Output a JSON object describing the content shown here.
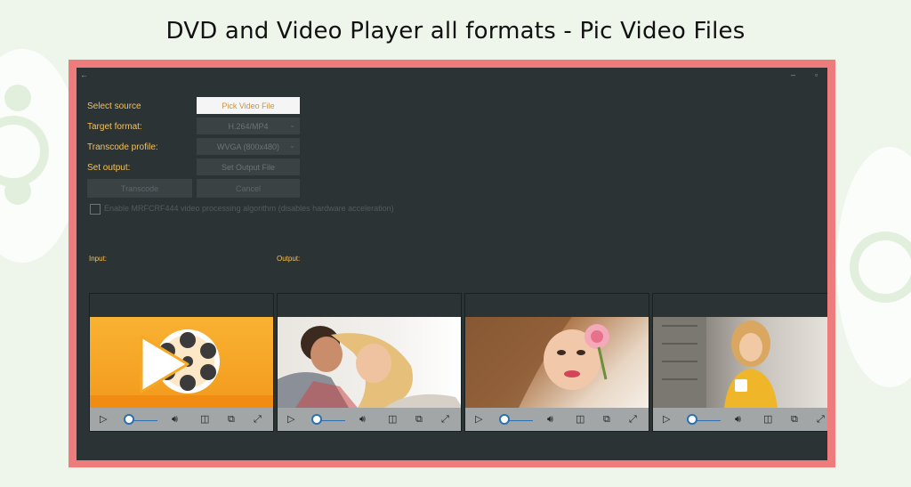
{
  "headline": "DVD and Video Player all formats - Pic Video Files",
  "app": {
    "back_icon": "←",
    "minimize_icon": "–",
    "restore_icon": "▫"
  },
  "form": {
    "select_source_label": "Select source",
    "pick_video_button": "Pick Video File",
    "target_format_label": "Target format:",
    "target_format_value": "H.264/MP4",
    "transcode_profile_label": "Transcode profile:",
    "transcode_profile_value": "WVGA (800x480)",
    "set_output_label": "Set output:",
    "set_output_button": "Set Output File",
    "transcode_button": "Transcode",
    "cancel_button": "Cancel",
    "checkbox_label": "Enable MRFCRF444 video processing algorithm (disables hardware acceleration)"
  },
  "sections": {
    "input_label": "Input:",
    "output_label": "Output:"
  },
  "controls": {
    "play_icon": "▷",
    "volume_icon": "🔊︎",
    "aspect_icon": "◫",
    "cast_icon": "⧉",
    "fullscreen_icon": "⤢"
  },
  "colors": {
    "accent_text": "#f6c25a",
    "frame_border": "#ee7c7c",
    "app_background": "#2c3334",
    "slider_accent": "#2f6fb0",
    "brand_orange": "#f6a623"
  }
}
